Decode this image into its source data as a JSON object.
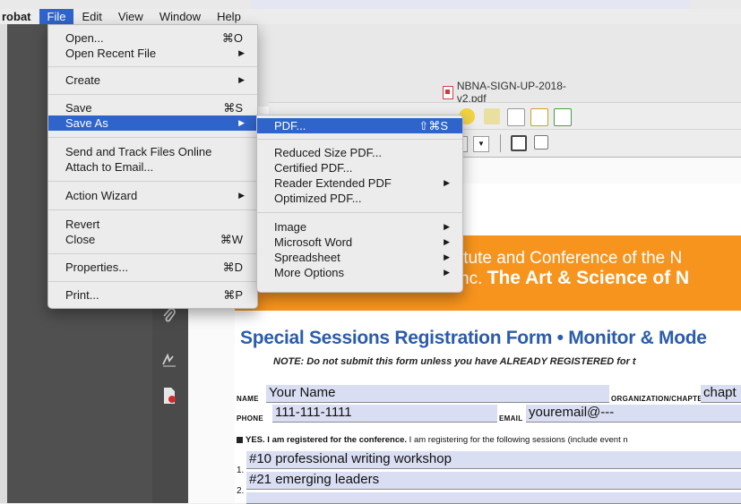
{
  "menubar": {
    "app": "robat",
    "items": [
      "File",
      "Edit",
      "View",
      "Window",
      "Help"
    ]
  },
  "file_menu": {
    "open": {
      "label": "Open...",
      "shortcut": "⌘O"
    },
    "open_recent": {
      "label": "Open Recent File"
    },
    "create": {
      "label": "Create"
    },
    "save": {
      "label": "Save",
      "shortcut": "⌘S"
    },
    "save_as": {
      "label": "Save As"
    },
    "send_track": {
      "label": "Send and Track Files Online"
    },
    "attach_email": {
      "label": "Attach to Email..."
    },
    "action_wizard": {
      "label": "Action Wizard"
    },
    "revert": {
      "label": "Revert"
    },
    "close": {
      "label": "Close",
      "shortcut": "⌘W"
    },
    "properties": {
      "label": "Properties...",
      "shortcut": "⌘D"
    },
    "print": {
      "label": "Print...",
      "shortcut": "⌘P"
    },
    "submenu_arrow": "▶"
  },
  "save_as_menu": {
    "pdf": {
      "label": "PDF...",
      "shortcut": "⇧⌘S"
    },
    "reduced": {
      "label": "Reduced Size PDF..."
    },
    "certified": {
      "label": "Certified PDF..."
    },
    "reader_extended": {
      "label": "Reader Extended PDF"
    },
    "optimized": {
      "label": "Optimized PDF..."
    },
    "image": {
      "label": "Image"
    },
    "word": {
      "label": "Microsoft Word"
    },
    "spreadsheet": {
      "label": "Spreadsheet"
    },
    "more": {
      "label": "More Options"
    }
  },
  "window": {
    "title": "NBNA-SIGN-UP-2018-v2.pdf"
  },
  "document": {
    "banner_line1": "itute and Conference of the N",
    "banner_line2_pre": "nc. ",
    "banner_line2_bold": "The Art & Science of N",
    "form_title": "Special Sessions Registration Form • Monitor & Mode",
    "note": "NOTE: Do not submit this form unless you have ALREADY REGISTERED for t",
    "name_label": "NAME",
    "name_value": "Your Name",
    "org_label": "ORGANIZATION/CHAPTER",
    "org_value": "chapt",
    "phone_label": "PHONE",
    "phone_value": "111-111-1111",
    "email_label": "EMAIL",
    "email_value": "youremail@---",
    "yes_bold": "YES. I am registered for the conference.",
    "yes_rest": " I am registering for the following sessions (include event n",
    "session1_num": "1.",
    "session1": "#10 professional writing workshop",
    "session2_num": "2.",
    "session2": "#21 emerging leaders"
  },
  "colors": {
    "menu_highlight": "#2f64cb",
    "banner": "#f7941d",
    "form_title": "#2b5cab",
    "field_bg": "#d9def3"
  }
}
